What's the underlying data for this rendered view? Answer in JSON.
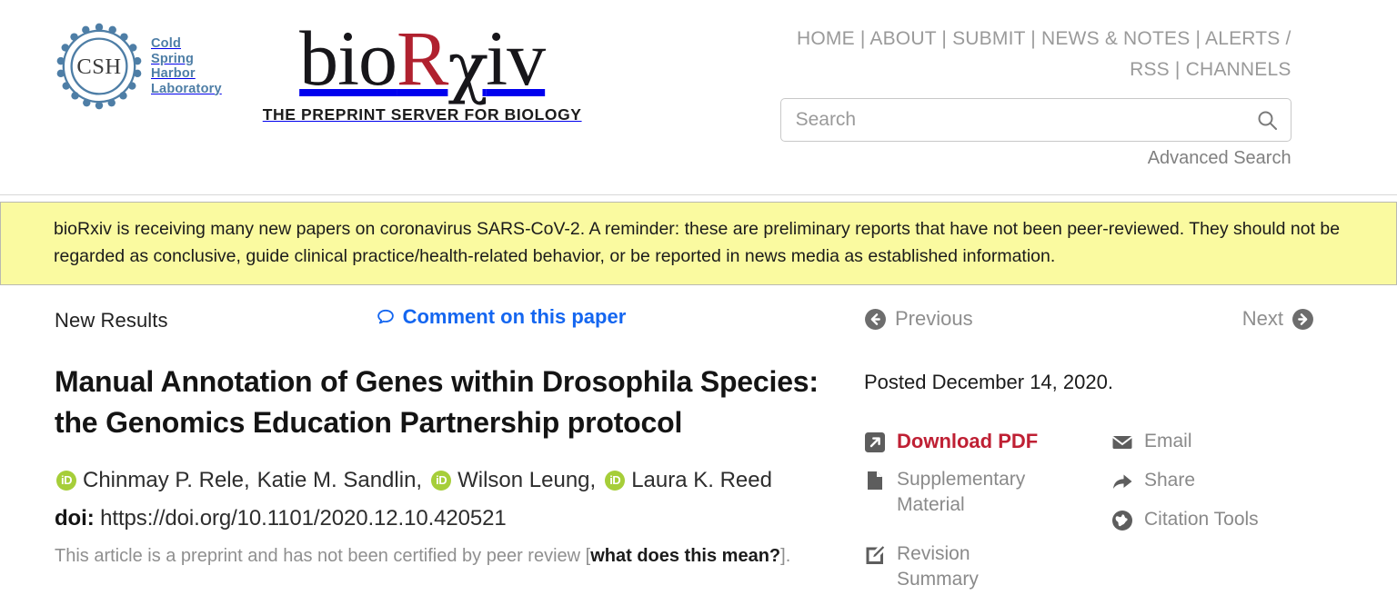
{
  "header": {
    "cshl_logo": {
      "mark_text": "CSH",
      "lines": [
        "Cold",
        "Spring",
        "Harbor",
        "Laboratory"
      ]
    },
    "biorxiv_logo": {
      "part1": "bio",
      "part_r": "R",
      "part_chi": "χ",
      "part2": "iv",
      "tagline": "THE PREPRINT SERVER FOR BIOLOGY",
      "accent_color": "#B0212F"
    },
    "nav": [
      "HOME",
      "ABOUT",
      "SUBMIT",
      "NEWS & NOTES",
      "ALERTS / RSS",
      "CHANNELS"
    ],
    "search": {
      "placeholder": "Search",
      "value": "",
      "icon": "search-icon",
      "advanced_label": "Advanced Search"
    }
  },
  "banner": {
    "text": "bioRxiv is receiving many new papers on coronavirus SARS-CoV-2.   A reminder: these are preliminary reports that have not been peer-reviewed. They should not be regarded as conclusive, guide clinical practice/health-related behavior, or be reported in news media as established information.",
    "background_color": "#FAFAA0"
  },
  "article": {
    "category_label": "New Results",
    "comment_link": {
      "label": "Comment on this paper",
      "icon": "comment-bubble-icon",
      "color": "#1466f0"
    },
    "title": "Manual Annotation of Genes within Drosophila Species: the Genomics Education Partnership protocol",
    "authors": [
      {
        "name": "Chinmay P. Rele,",
        "orcid": true
      },
      {
        "name": "Katie M. Sandlin,",
        "orcid": false
      },
      {
        "name": "Wilson Leung,",
        "orcid": true
      },
      {
        "name": "Laura K. Reed",
        "orcid": true
      }
    ],
    "doi_label": "doi:",
    "doi_value": "https://doi.org/10.1101/2020.12.10.420521",
    "preprint_note_before": "This article is a preprint and has not been certified by peer review [",
    "preprint_note_link": "what does this mean?",
    "preprint_note_after": "]."
  },
  "sidebar": {
    "previous_label": "Previous",
    "next_label": "Next",
    "posted_date": "Posted December 14, 2020.",
    "tools_primary": [
      {
        "label": "Download PDF",
        "icon": "external-link-icon",
        "style": "pdf"
      },
      {
        "label": "Supplementary Material",
        "icon": "document-icon",
        "style": "normal"
      },
      {
        "label": "Revision Summary",
        "icon": "edit-pencil-icon",
        "style": "normal"
      }
    ],
    "tools_secondary": [
      {
        "label": "Email",
        "icon": "envelope-icon"
      },
      {
        "label": "Share",
        "icon": "share-arrow-icon"
      },
      {
        "label": "Citation Tools",
        "icon": "globe-icon"
      }
    ]
  }
}
